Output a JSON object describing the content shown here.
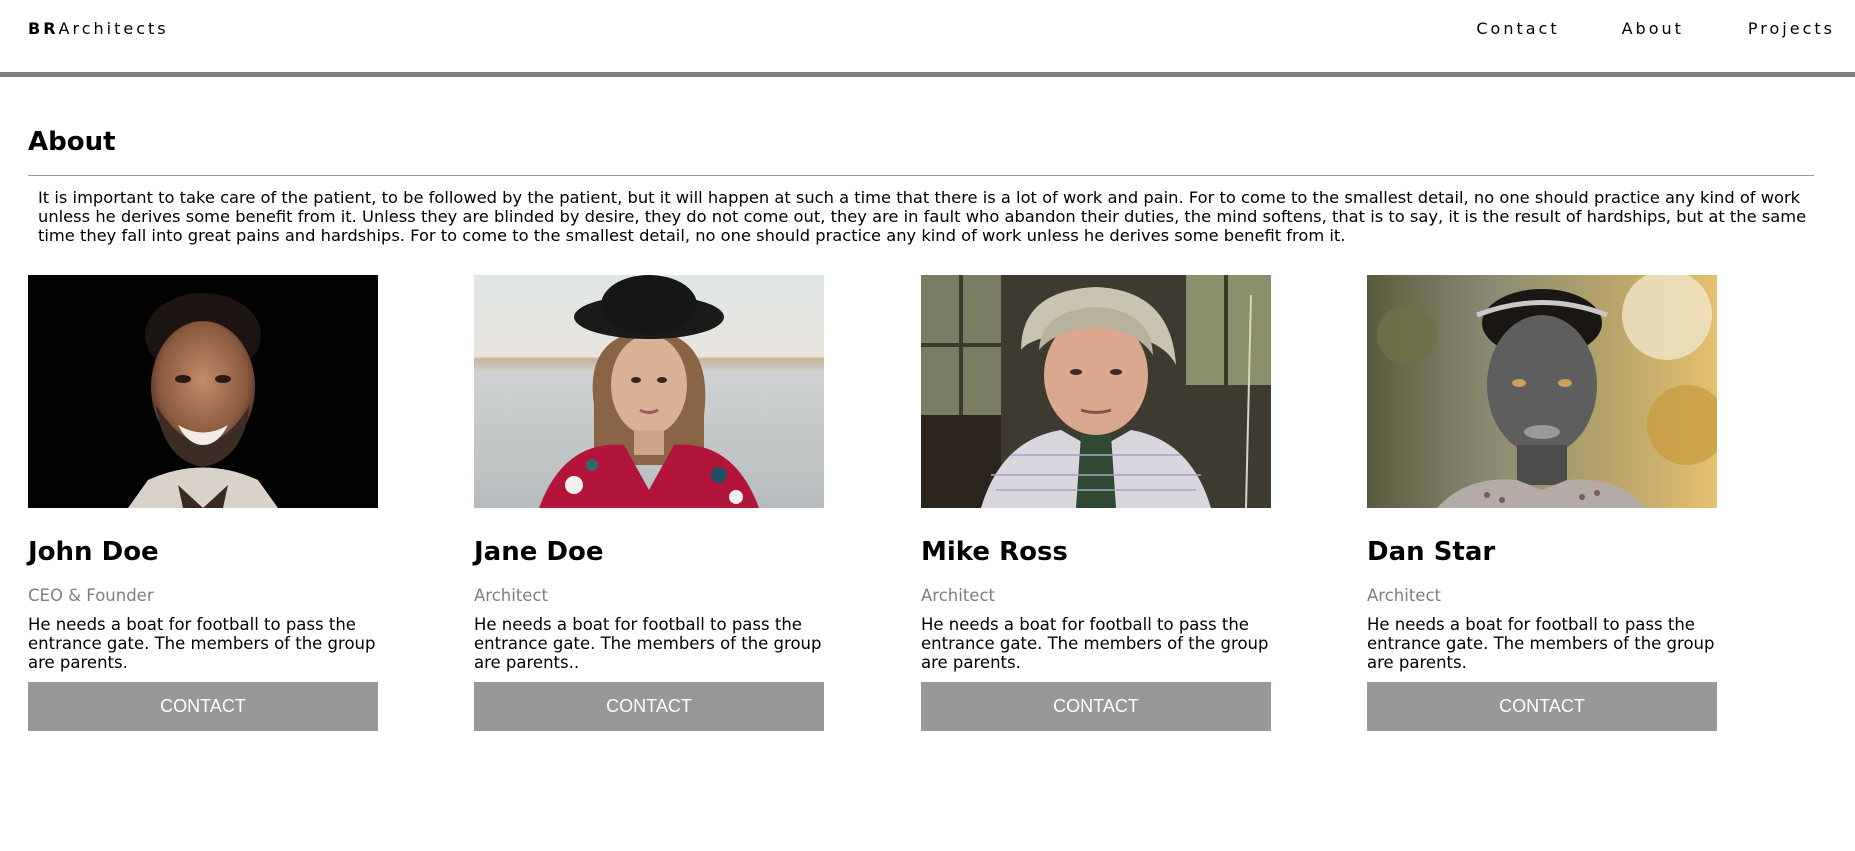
{
  "header": {
    "logo_bold": "BR",
    "logo_rest": "Architects",
    "nav": [
      "Contact",
      "About",
      "Projects"
    ]
  },
  "about": {
    "title": "About",
    "text": "It is important to take care of the patient, to be followed by the patient, but it will happen at such a time that there is a lot of work and pain. For to come to the smallest detail, no one should practice any kind of work unless he derives some benefit from it. Unless they are blinded by desire, they do not come out, they are in fault who abandon their duties, the mind softens, that is to say, it is the result of hardships, but at the same time they fall into great pains and hardships. For to come to the smallest detail, no one should practice any kind of work unless he derives some benefit from it."
  },
  "team": [
    {
      "name": "John Doe",
      "role": "CEO & Founder",
      "desc": "He needs a boat for football to pass the entrance gate. The members of the group are parents.",
      "button": "CONTACT"
    },
    {
      "name": "Jane Doe",
      "role": "Architect",
      "desc": "He needs a boat for football to pass the entrance gate. The members of the group are parents..",
      "button": "CONTACT"
    },
    {
      "name": "Mike Ross",
      "role": "Architect",
      "desc": "He needs a boat for football to pass the entrance gate. The members of the group are parents.",
      "button": "CONTACT"
    },
    {
      "name": "Dan Star",
      "role": "Architect",
      "desc": "He needs a boat for football to pass the entrance gate. The members of the group are parents.",
      "button": "CONTACT"
    }
  ],
  "colors": {
    "header_border": "#828282",
    "button_bg": "#9a9896",
    "role_text": "#7f7f7f"
  }
}
